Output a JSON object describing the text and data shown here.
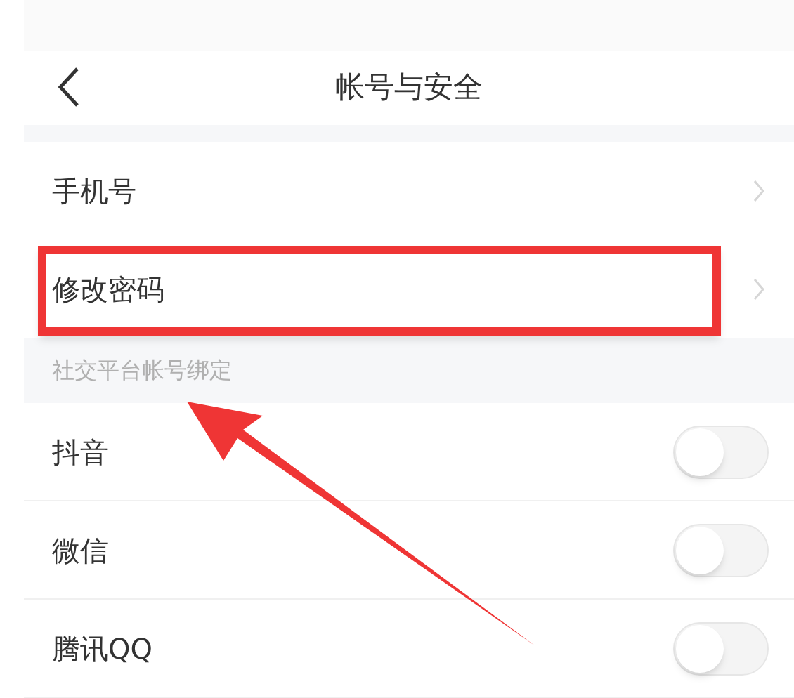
{
  "nav": {
    "title": "帐号与安全"
  },
  "rows": [
    {
      "label": "手机号",
      "highlighted": false
    },
    {
      "label": "修改密码",
      "highlighted": true
    }
  ],
  "section": {
    "title": "社交平台帐号绑定"
  },
  "bindings": [
    {
      "label": "抖音",
      "on": false
    },
    {
      "label": "微信",
      "on": false
    },
    {
      "label": "腾讯QQ",
      "on": false
    }
  ]
}
